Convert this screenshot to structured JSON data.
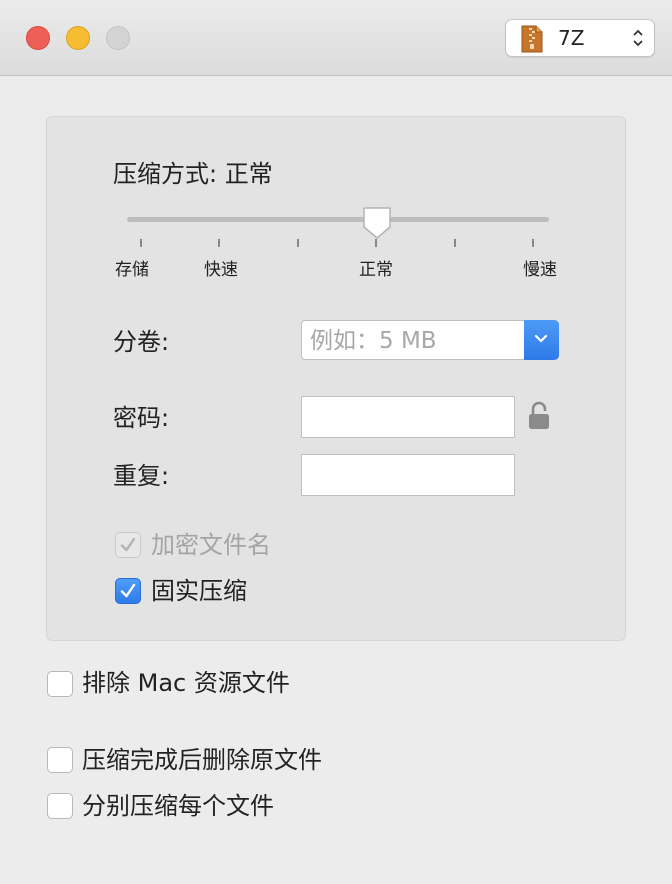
{
  "window": {
    "format_selector": {
      "icon": "archive-zip-icon",
      "value": "7Z"
    }
  },
  "compression": {
    "method_label": "压缩方式:",
    "method_value": "正常",
    "level_labels": [
      "存储",
      "快速",
      "正常",
      "慢速"
    ],
    "slider_value": "正常"
  },
  "split": {
    "label": "分卷:",
    "placeholder": "例如：5 MB"
  },
  "password": {
    "label": "密码:",
    "value": ""
  },
  "repeat": {
    "label": "重复:",
    "value": ""
  },
  "options": {
    "encrypt_filenames": {
      "label": "加密文件名",
      "checked": true,
      "disabled": true
    },
    "solid": {
      "label": "固实压缩",
      "checked": true
    }
  },
  "extra_options": [
    {
      "label": "排除 Mac 资源文件",
      "checked": false
    },
    {
      "label": "压缩完成后删除原文件",
      "checked": false
    },
    {
      "label": "分别压缩每个文件",
      "checked": false
    }
  ],
  "colors": {
    "accent": "#2f7ae9",
    "close": "#ee5f57",
    "minimize": "#f6bd32"
  }
}
